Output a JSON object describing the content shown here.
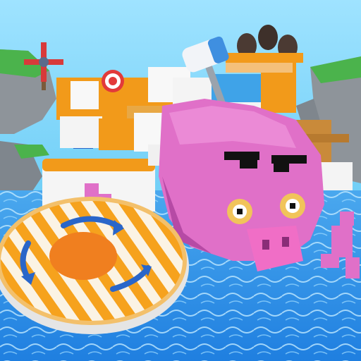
{
  "scene": {
    "colors": {
      "sky": "#8edcff",
      "water": "#2f8fe6",
      "water_light": "#7fd0ff",
      "pig_pink": "#e070c8",
      "pig_dark": "#b64aa5",
      "wood": "#c98a3a",
      "orange": "#f29a1a",
      "white_block": "#f4f4f4",
      "rock": "#8e949a",
      "grass": "#49b34a",
      "arrow_blue": "#2a66c9"
    },
    "icons": {
      "spinner_arrows": "rotate-arrows-icon",
      "fan": "windmill-icon",
      "target": "bullseye-target-icon",
      "hammer": "giant-hammer-icon",
      "barrels": "barrels-icon"
    }
  }
}
